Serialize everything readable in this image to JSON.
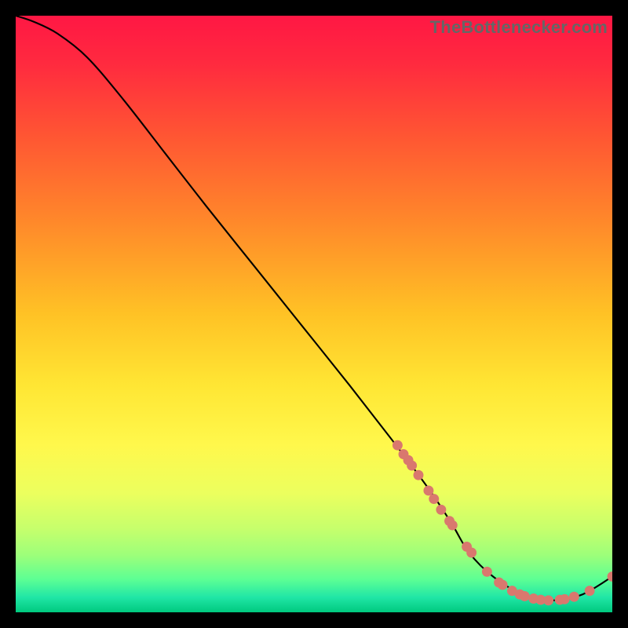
{
  "watermark": "TheBottlenecker.com",
  "chart_data": {
    "type": "line",
    "title": "",
    "xlabel": "",
    "ylabel": "",
    "xlim": [
      0,
      100
    ],
    "ylim": [
      0,
      100
    ],
    "gradient_stops": [
      {
        "offset": 0.0,
        "color": "#ff1744"
      },
      {
        "offset": 0.08,
        "color": "#ff2a3f"
      },
      {
        "offset": 0.2,
        "color": "#ff5533"
      },
      {
        "offset": 0.35,
        "color": "#ff8a2a"
      },
      {
        "offset": 0.5,
        "color": "#ffc225"
      },
      {
        "offset": 0.62,
        "color": "#ffe634"
      },
      {
        "offset": 0.72,
        "color": "#fff84c"
      },
      {
        "offset": 0.8,
        "color": "#ecff5e"
      },
      {
        "offset": 0.86,
        "color": "#c6ff6c"
      },
      {
        "offset": 0.905,
        "color": "#9cff7a"
      },
      {
        "offset": 0.945,
        "color": "#5cff94"
      },
      {
        "offset": 0.975,
        "color": "#20e6a6"
      },
      {
        "offset": 1.0,
        "color": "#00c97e"
      }
    ],
    "series": [
      {
        "name": "bottleneck-curve",
        "x": [
          0,
          3,
          7,
          12,
          18,
          25,
          32,
          40,
          48,
          56,
          63,
          69,
          73,
          76,
          80,
          85,
          90,
          95,
          100
        ],
        "y": [
          100,
          99,
          97,
          93,
          86,
          77,
          68,
          58,
          48,
          38,
          29,
          21,
          15,
          10,
          6,
          3,
          2,
          3,
          6
        ]
      }
    ],
    "markers": {
      "name": "sample-points",
      "color": "#d9786e",
      "points": [
        {
          "x": 64.0,
          "y": 28.0
        },
        {
          "x": 65.0,
          "y": 26.5
        },
        {
          "x": 65.8,
          "y": 25.5
        },
        {
          "x": 66.4,
          "y": 24.6
        },
        {
          "x": 67.5,
          "y": 23.0
        },
        {
          "x": 69.2,
          "y": 20.4
        },
        {
          "x": 70.1,
          "y": 19.0
        },
        {
          "x": 71.3,
          "y": 17.2
        },
        {
          "x": 72.7,
          "y": 15.3
        },
        {
          "x": 73.2,
          "y": 14.6
        },
        {
          "x": 75.6,
          "y": 11.0
        },
        {
          "x": 76.4,
          "y": 10.0
        },
        {
          "x": 79.0,
          "y": 6.8
        },
        {
          "x": 81.0,
          "y": 5.0
        },
        {
          "x": 81.6,
          "y": 4.6
        },
        {
          "x": 83.2,
          "y": 3.6
        },
        {
          "x": 84.5,
          "y": 3.0
        },
        {
          "x": 85.3,
          "y": 2.7
        },
        {
          "x": 86.8,
          "y": 2.3
        },
        {
          "x": 88.0,
          "y": 2.1
        },
        {
          "x": 89.3,
          "y": 2.0
        },
        {
          "x": 91.2,
          "y": 2.1
        },
        {
          "x": 92.0,
          "y": 2.2
        },
        {
          "x": 93.6,
          "y": 2.6
        },
        {
          "x": 96.2,
          "y": 3.6
        },
        {
          "x": 100.0,
          "y": 6.0
        }
      ]
    }
  }
}
